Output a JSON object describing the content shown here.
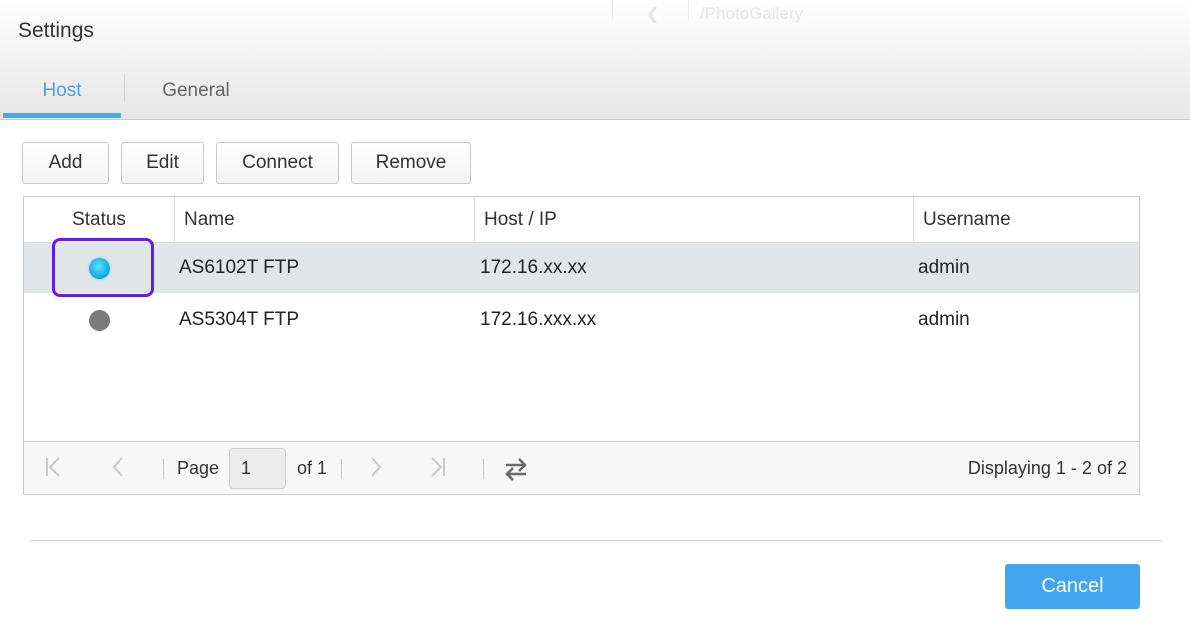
{
  "background": {
    "path": "/PhotoGallery"
  },
  "dialog": {
    "title": "Settings"
  },
  "tabs": [
    {
      "label": "Host",
      "active": true
    },
    {
      "label": "General",
      "active": false
    }
  ],
  "toolbar": {
    "add": "Add",
    "edit": "Edit",
    "connect": "Connect",
    "remove": "Remove"
  },
  "table": {
    "columns": [
      "Status",
      "Name",
      "Host / IP",
      "Username"
    ],
    "rows": [
      {
        "status": "online",
        "name": "AS6102T FTP",
        "host": "172.16.xx.xx",
        "username": "admin",
        "selected": true
      },
      {
        "status": "offline",
        "name": "AS5304T FTP",
        "host": "172.16.xxx.xx",
        "username": "admin",
        "selected": false
      }
    ]
  },
  "pager": {
    "page_label": "Page",
    "page_value": "1",
    "of_label": "of 1",
    "display": "Displaying 1 - 2 of 2"
  },
  "footer": {
    "cancel": "Cancel"
  },
  "colors": {
    "accent": "#3fb0ea",
    "cancel_button": "#42a5f0",
    "status_online": "#1bb3e6",
    "status_offline": "#7a7a7a",
    "highlight": "#5b21e6",
    "selected_row": "#e2e5e8"
  },
  "icons": [
    "first-page-icon",
    "prev-page-icon",
    "next-page-icon",
    "last-page-icon",
    "refresh-icon",
    "back-chevron-icon"
  ]
}
